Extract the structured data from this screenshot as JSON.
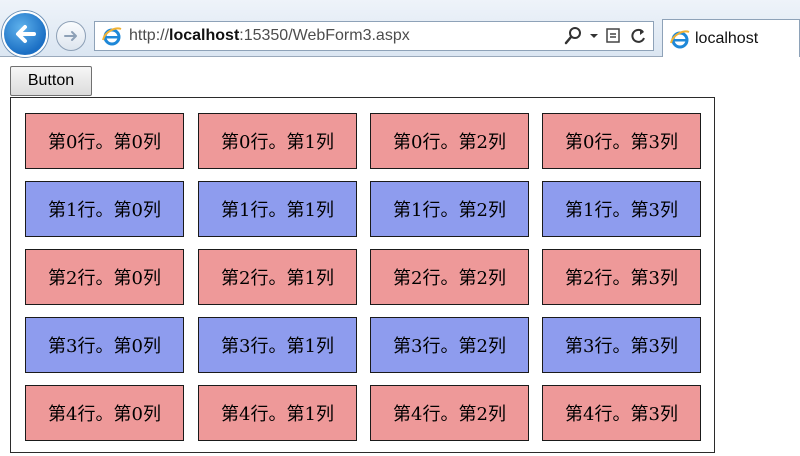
{
  "browser": {
    "url_prefix": "http://",
    "url_host": "localhost",
    "url_rest": ":15350/WebForm3.aspx",
    "tab_title": "localhost"
  },
  "page": {
    "button_label": "Button"
  },
  "colors": {
    "even_row": "#ee9999",
    "odd_row": "#8e9cee"
  },
  "grid": {
    "rows": [
      [
        "第0行。第0列",
        "第0行。第1列",
        "第0行。第2列",
        "第0行。第3列"
      ],
      [
        "第1行。第0列",
        "第1行。第1列",
        "第1行。第2列",
        "第1行。第3列"
      ],
      [
        "第2行。第0列",
        "第2行。第1列",
        "第2行。第2列",
        "第2行。第3列"
      ],
      [
        "第3行。第0列",
        "第3行。第1列",
        "第3行。第2列",
        "第3行。第3列"
      ],
      [
        "第4行。第0列",
        "第4行。第1列",
        "第4行。第2列",
        "第4行。第3列"
      ]
    ]
  }
}
